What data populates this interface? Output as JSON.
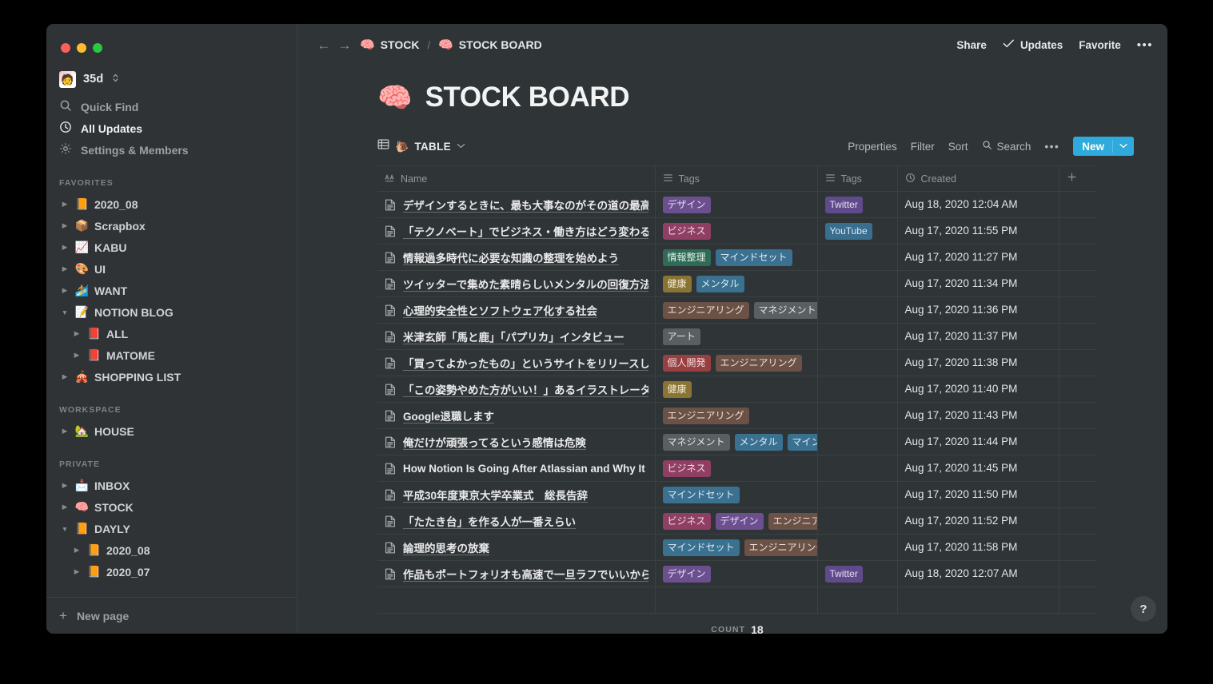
{
  "window": {
    "traffic_lights": [
      "close",
      "minimize",
      "zoom"
    ]
  },
  "sidebar": {
    "workspace": {
      "name": "35d",
      "avatar_emoji": "🧑"
    },
    "nav": [
      {
        "label": "Quick Find",
        "icon": "search-icon",
        "active": false
      },
      {
        "label": "All Updates",
        "icon": "clock-icon",
        "active": true
      },
      {
        "label": "Settings & Members",
        "icon": "gear-icon",
        "active": false
      }
    ],
    "sections": [
      {
        "title": "FAVORITES",
        "items": [
          {
            "label": "2020_08",
            "emoji": "📙",
            "arrow": "right",
            "level": 1
          },
          {
            "label": "Scrapbox",
            "emoji": "📦",
            "arrow": "right",
            "level": 1
          },
          {
            "label": "KABU",
            "emoji": "📈",
            "arrow": "right",
            "level": 1
          },
          {
            "label": "UI",
            "emoji": "🎨",
            "arrow": "right",
            "level": 1
          },
          {
            "label": "WANT",
            "emoji": "🏄",
            "arrow": "right",
            "level": 1
          },
          {
            "label": "NOTION BLOG",
            "emoji": "📝",
            "arrow": "down",
            "level": 1
          },
          {
            "label": "ALL",
            "emoji": "📕",
            "arrow": "right",
            "level": 2
          },
          {
            "label": "MATOME",
            "emoji": "📕",
            "arrow": "right",
            "level": 2
          },
          {
            "label": "SHOPPING LIST",
            "emoji": "🎪",
            "arrow": "right",
            "level": 1
          }
        ]
      },
      {
        "title": "WORKSPACE",
        "items": [
          {
            "label": "HOUSE",
            "emoji": "🏡",
            "arrow": "right",
            "level": 1
          }
        ]
      },
      {
        "title": "PRIVATE",
        "items": [
          {
            "label": "INBOX",
            "emoji": "📩",
            "arrow": "right",
            "level": 1
          },
          {
            "label": "STOCK",
            "emoji": "🧠",
            "arrow": "right",
            "level": 1
          },
          {
            "label": "DAYLY",
            "emoji": "📙",
            "arrow": "down",
            "level": 1
          },
          {
            "label": "2020_08",
            "emoji": "📙",
            "arrow": "right",
            "level": 2
          },
          {
            "label": "2020_07",
            "emoji": "📙",
            "arrow": "right",
            "level": 2
          }
        ]
      }
    ],
    "new_page_label": "New page"
  },
  "topbar": {
    "back_glyph": "←",
    "forward_glyph": "→",
    "breadcrumbs": [
      {
        "emoji": "🧠",
        "label": "STOCK"
      },
      {
        "emoji": "🧠",
        "label": "STOCK BOARD"
      }
    ],
    "separator": "/",
    "share_label": "Share",
    "updates_label": "Updates",
    "favorite_label": "Favorite",
    "more_label": "•••"
  },
  "page": {
    "emoji": "🧠",
    "title": "STOCK BOARD"
  },
  "viewbar": {
    "view_emoji": "🐌",
    "view_label": "TABLE",
    "view_caret": "⌄",
    "properties_label": "Properties",
    "filter_label": "Filter",
    "sort_label": "Sort",
    "search_label": "Search",
    "more_label": "•••",
    "new_label": "New",
    "new_caret": "⌄",
    "new_color": "#2eaadc"
  },
  "table": {
    "columns": [
      {
        "label": "Name",
        "icon": "text-aa-icon"
      },
      {
        "label": "Tags",
        "icon": "multiselect-icon"
      },
      {
        "label": "Tags",
        "icon": "multiselect-icon"
      },
      {
        "label": "Created",
        "icon": "clock-icon"
      },
      {
        "label": "",
        "icon": "plus-icon"
      }
    ],
    "rows": [
      {
        "name": "デザインするときに、最も大事なのがその道の最高レベ",
        "tags1": [
          {
            "text": "デザイン",
            "color": "#6b4f8f",
            "fg": "#e7e1f2"
          }
        ],
        "tags2": [
          {
            "text": "Twitter",
            "color": "#604a8c",
            "fg": "#e5e0f0"
          }
        ],
        "created": "Aug 18, 2020 12:04 AM"
      },
      {
        "name": "「テクノベート」でビジネス・働き方はどう変わるのか",
        "tags1": [
          {
            "text": "ビジネス",
            "color": "#8f3f63",
            "fg": "#f2dee7"
          }
        ],
        "tags2": [
          {
            "text": "YouTube",
            "color": "#3a6e8f",
            "fg": "#dbe9f2"
          }
        ],
        "created": "Aug 17, 2020 11:55 PM"
      },
      {
        "name": "情報過多時代に必要な知識の整理を始めよう",
        "tags1": [
          {
            "text": "情報整理",
            "color": "#2f6b56",
            "fg": "#dff0e8"
          },
          {
            "text": "マインドセット",
            "color": "#3a7190",
            "fg": "#deecf4"
          }
        ],
        "tags2": [],
        "created": "Aug 17, 2020 11:27 PM"
      },
      {
        "name": "ツイッターで集めた素晴らしいメンタルの回復方法",
        "tags1": [
          {
            "text": "健康",
            "color": "#897434",
            "fg": "#f4ecd4"
          },
          {
            "text": "メンタル",
            "color": "#3a7190",
            "fg": "#deecf4"
          }
        ],
        "tags2": [],
        "created": "Aug 17, 2020 11:34 PM"
      },
      {
        "name": "心理的安全性とソフトウェア化する社会",
        "tags1": [
          {
            "text": "エンジニアリング",
            "color": "#6b5146",
            "fg": "#eee2da"
          },
          {
            "text": "マネジメント",
            "color": "#5a5f61",
            "fg": "#e3e6e7"
          }
        ],
        "tags2": [],
        "created": "Aug 17, 2020 11:36 PM"
      },
      {
        "name": "米津玄師「馬と鹿」「パプリカ」インタビュー",
        "tags1": [
          {
            "text": "アート",
            "color": "#5a5f61",
            "fg": "#e3e6e7"
          }
        ],
        "tags2": [],
        "created": "Aug 17, 2020 11:37 PM"
      },
      {
        "name": "「買ってよかったもの」というサイトをリリースした",
        "tags1": [
          {
            "text": "個人開発",
            "color": "#973f41",
            "fg": "#f4dede"
          },
          {
            "text": "エンジニアリング",
            "color": "#6b5146",
            "fg": "#eee2da"
          }
        ],
        "tags2": [],
        "created": "Aug 17, 2020 11:38 PM"
      },
      {
        "name": "「この姿勢やめた方がいい！」あるイラストレーターさ",
        "tags1": [
          {
            "text": "健康",
            "color": "#897434",
            "fg": "#f4ecd4"
          }
        ],
        "tags2": [],
        "created": "Aug 17, 2020 11:40 PM"
      },
      {
        "name": "Google退職します",
        "tags1": [
          {
            "text": "エンジニアリング",
            "color": "#6b5146",
            "fg": "#eee2da"
          }
        ],
        "tags2": [],
        "created": "Aug 17, 2020 11:43 PM"
      },
      {
        "name": "俺だけが頑張ってるという感情は危険",
        "tags1": [
          {
            "text": "マネジメント",
            "color": "#5a5f61",
            "fg": "#e3e6e7"
          },
          {
            "text": "メンタル",
            "color": "#3a7190",
            "fg": "#deecf4"
          },
          {
            "text": "マインドセット",
            "color": "#3a7190",
            "fg": "#deecf4"
          }
        ],
        "tags2": [],
        "created": "Aug 17, 2020 11:44 PM"
      },
      {
        "name": "How Notion Is Going After Atlassian and Why It",
        "tags1": [
          {
            "text": "ビジネス",
            "color": "#8f3f63",
            "fg": "#f2dee7"
          }
        ],
        "tags2": [],
        "created": "Aug 17, 2020 11:45 PM"
      },
      {
        "name": "平成30年度東京大学卒業式　総長告辞",
        "tags1": [
          {
            "text": "マインドセット",
            "color": "#3a7190",
            "fg": "#deecf4"
          }
        ],
        "tags2": [],
        "created": "Aug 17, 2020 11:50 PM"
      },
      {
        "name": "「たたき台」を作る人が一番えらい",
        "tags1": [
          {
            "text": "ビジネス",
            "color": "#8f3f63",
            "fg": "#f2dee7"
          },
          {
            "text": "デザイン",
            "color": "#6b4f8f",
            "fg": "#e7e1f2"
          },
          {
            "text": "エンジニアリング",
            "color": "#6b5146",
            "fg": "#eee2da"
          }
        ],
        "tags2": [],
        "created": "Aug 17, 2020 11:52 PM"
      },
      {
        "name": "論理的思考の放棄",
        "tags1": [
          {
            "text": "マインドセット",
            "color": "#3a7190",
            "fg": "#deecf4"
          },
          {
            "text": "エンジニアリング",
            "color": "#6b5146",
            "fg": "#eee2da"
          }
        ],
        "tags2": [],
        "created": "Aug 17, 2020 11:58 PM"
      },
      {
        "name": "作品もポートフォリオも高速で一旦ラフでいいから形に",
        "tags1": [
          {
            "text": "デザイン",
            "color": "#6b4f8f",
            "fg": "#e7e1f2"
          }
        ],
        "tags2": [
          {
            "text": "Twitter",
            "color": "#604a8c",
            "fg": "#e5e0f0"
          }
        ],
        "created": "Aug 18, 2020 12:07 AM"
      }
    ],
    "count_label": "COUNT",
    "count_value": "18"
  },
  "help": {
    "glyph": "?"
  }
}
